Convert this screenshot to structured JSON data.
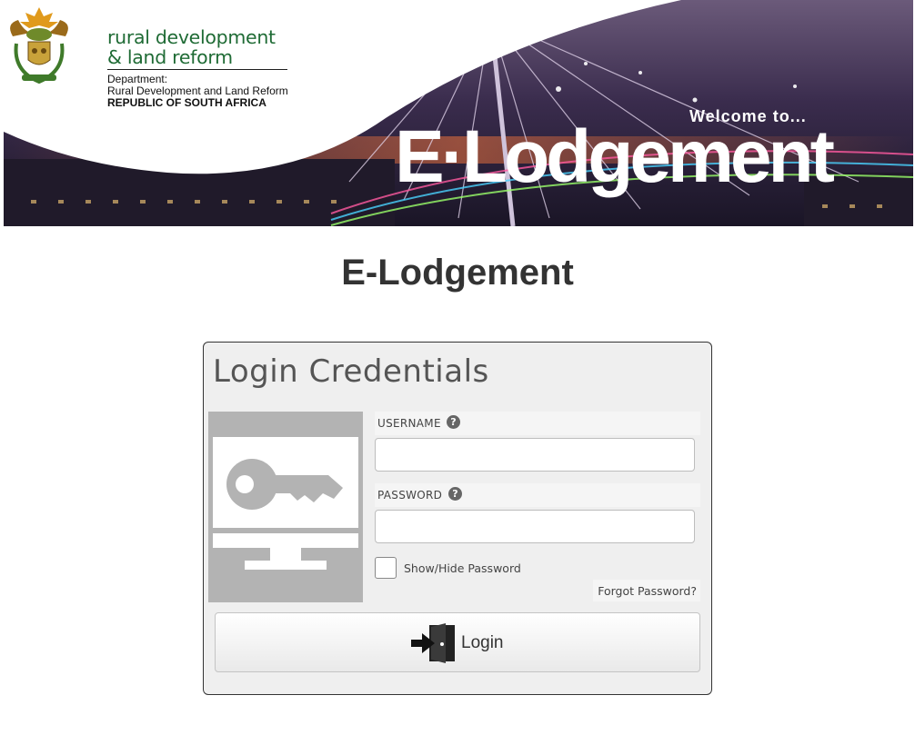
{
  "banner": {
    "department_name_line1": "rural development",
    "department_name_line2": "& land reform",
    "department_label": "Department:",
    "department_full": "Rural Development and Land Reform",
    "country": "REPUBLIC OF SOUTH AFRICA",
    "welcome": "Welcome to...",
    "brand": "E·Lodgement"
  },
  "page": {
    "title": "E-Lodgement"
  },
  "login": {
    "title": "Login Credentials",
    "username_label": "USERNAME",
    "username_value": "",
    "password_label": "PASSWORD",
    "password_value": "",
    "help_icon_glyph": "?",
    "show_hide_label": "Show/Hide Password",
    "show_hide_checked": false,
    "forgot_label": "Forgot Password?",
    "login_button_label": "Login"
  },
  "colors": {
    "brand_green": "#1f6b35",
    "title_text": "#333333",
    "card_background": "#efefef",
    "illustration_grey": "#b3b3b3"
  },
  "icons": [
    "coat-of-arms-icon",
    "key-monitor-icon",
    "help-icon",
    "login-door-icon"
  ]
}
